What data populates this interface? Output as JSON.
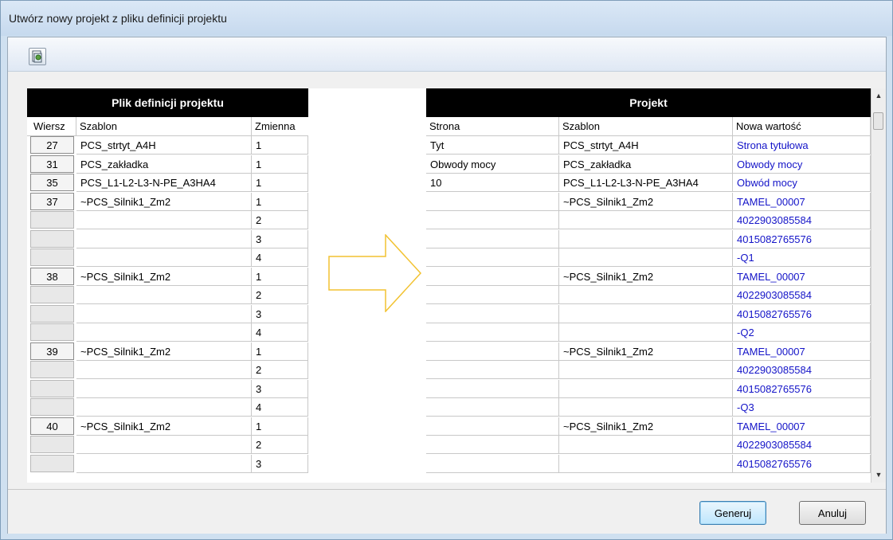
{
  "window": {
    "title": "Utwórz nowy projekt z pliku definicji projektu"
  },
  "toolbar": {
    "icon": "import-icon"
  },
  "left": {
    "header": "Plik definicji projektu",
    "columns": [
      "Wiersz",
      "Szablon",
      "Zmienna"
    ]
  },
  "right": {
    "header": "Projekt",
    "columns": [
      "Strona",
      "Szablon",
      "Nowa wartość"
    ]
  },
  "rows": [
    {
      "wiersz": "27",
      "szablon": "PCS_strtyt_A4H",
      "zmienna": "1",
      "strona": "Tyt",
      "pszablon": "PCS_strtyt_A4H",
      "nowa": "Strona tytułowa"
    },
    {
      "wiersz": "31",
      "szablon": "PCS_zakładka",
      "zmienna": "1",
      "strona": "Obwody mocy",
      "pszablon": "PCS_zakładka",
      "nowa": "Obwody mocy"
    },
    {
      "wiersz": "35",
      "szablon": "PCS_L1-L2-L3-N-PE_A3HA4",
      "zmienna": "1",
      "strona": "10",
      "pszablon": "PCS_L1-L2-L3-N-PE_A3HA4",
      "nowa": "Obwód mocy"
    },
    {
      "wiersz": "37",
      "szablon": "~PCS_Silnik1_Zm2",
      "zmienna": "1",
      "strona": "",
      "pszablon": "~PCS_Silnik1_Zm2",
      "nowa": "TAMEL_00007"
    },
    {
      "wiersz": "",
      "szablon": "",
      "zmienna": "2",
      "strona": "",
      "pszablon": "",
      "nowa": "4022903085584"
    },
    {
      "wiersz": "",
      "szablon": "",
      "zmienna": "3",
      "strona": "",
      "pszablon": "",
      "nowa": "4015082765576"
    },
    {
      "wiersz": "",
      "szablon": "",
      "zmienna": "4",
      "strona": "",
      "pszablon": "",
      "nowa": "-Q1"
    },
    {
      "wiersz": "38",
      "szablon": "~PCS_Silnik1_Zm2",
      "zmienna": "1",
      "strona": "",
      "pszablon": "~PCS_Silnik1_Zm2",
      "nowa": "TAMEL_00007"
    },
    {
      "wiersz": "",
      "szablon": "",
      "zmienna": "2",
      "strona": "",
      "pszablon": "",
      "nowa": "4022903085584"
    },
    {
      "wiersz": "",
      "szablon": "",
      "zmienna": "3",
      "strona": "",
      "pszablon": "",
      "nowa": "4015082765576"
    },
    {
      "wiersz": "",
      "szablon": "",
      "zmienna": "4",
      "strona": "",
      "pszablon": "",
      "nowa": "-Q2"
    },
    {
      "wiersz": "39",
      "szablon": "~PCS_Silnik1_Zm2",
      "zmienna": "1",
      "strona": "",
      "pszablon": "~PCS_Silnik1_Zm2",
      "nowa": "TAMEL_00007"
    },
    {
      "wiersz": "",
      "szablon": "",
      "zmienna": "2",
      "strona": "",
      "pszablon": "",
      "nowa": "4022903085584"
    },
    {
      "wiersz": "",
      "szablon": "",
      "zmienna": "3",
      "strona": "",
      "pszablon": "",
      "nowa": "4015082765576"
    },
    {
      "wiersz": "",
      "szablon": "",
      "zmienna": "4",
      "strona": "",
      "pszablon": "",
      "nowa": "-Q3"
    },
    {
      "wiersz": "40",
      "szablon": "~PCS_Silnik1_Zm2",
      "zmienna": "1",
      "strona": "",
      "pszablon": "~PCS_Silnik1_Zm2",
      "nowa": "TAMEL_00007"
    },
    {
      "wiersz": "",
      "szablon": "",
      "zmienna": "2",
      "strona": "",
      "pszablon": "",
      "nowa": "4022903085584"
    },
    {
      "wiersz": "",
      "szablon": "",
      "zmienna": "3",
      "strona": "",
      "pszablon": "",
      "nowa": "4015082765576"
    }
  ],
  "buttons": {
    "generate": "Generuj",
    "cancel": "Anuluj"
  },
  "colors": {
    "value_blue": "#1414c8",
    "arrow": "#f2c230",
    "header_bg": "#000000"
  }
}
